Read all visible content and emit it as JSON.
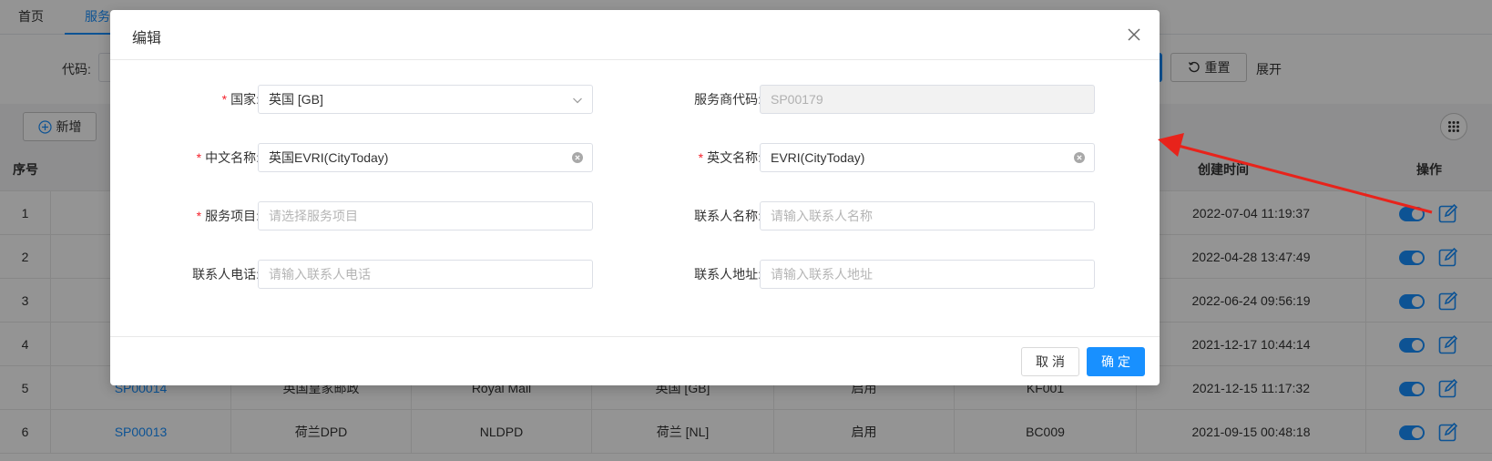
{
  "tabs": [
    "首页",
    "服务"
  ],
  "search": {
    "code_label": "代码:",
    "reset_label": "重置",
    "expand_label": "展开"
  },
  "toolbar": {
    "add_label": "新增"
  },
  "table": {
    "headers": {
      "index": "序号",
      "created": "创建时间",
      "actions": "操作"
    },
    "rows": [
      {
        "index": "1",
        "code": "",
        "cn": "",
        "en": "",
        "country": "",
        "status": "",
        "ext": "",
        "created": "2022-07-04 11:19:37"
      },
      {
        "index": "2",
        "code": "",
        "cn": "",
        "en": "",
        "country": "",
        "status": "",
        "ext": "",
        "created": "2022-04-28 13:47:49"
      },
      {
        "index": "3",
        "code": "",
        "cn": "",
        "en": "",
        "country": "",
        "status": "",
        "ext": "",
        "created": "2022-06-24 09:56:19"
      },
      {
        "index": "4",
        "code": "",
        "cn": "",
        "en": "",
        "country": "",
        "status": "",
        "ext": "",
        "created": "2021-12-17 10:44:14"
      },
      {
        "index": "5",
        "code": "SP00014",
        "cn": "英国皇家邮政",
        "en": "Royal Mail",
        "country": "英国 [GB]",
        "status": "启用",
        "ext": "KF001",
        "created": "2021-12-15 11:17:32"
      },
      {
        "index": "6",
        "code": "SP00013",
        "cn": "荷兰DPD",
        "en": "NLDPD",
        "country": "荷兰 [NL]",
        "status": "启用",
        "ext": "BC009",
        "created": "2021-09-15 00:48:18"
      }
    ]
  },
  "modal": {
    "title": "编辑",
    "fields": {
      "country": {
        "label": "国家:",
        "value": "英国 [GB]"
      },
      "provider_code": {
        "label": "服务商代码:",
        "value": "SP00179"
      },
      "cn_name": {
        "label": "中文名称:",
        "value": "英国EVRI(CityToday)"
      },
      "en_name": {
        "label": "英文名称:",
        "value": "EVRI(CityToday)"
      },
      "service_item": {
        "label": "服务项目:",
        "placeholder": "请选择服务项目"
      },
      "contact_name": {
        "label": "联系人名称:",
        "placeholder": "请输入联系人名称"
      },
      "contact_phone": {
        "label": "联系人电话:",
        "placeholder": "请输入联系人电话"
      },
      "contact_address": {
        "label": "联系人地址:",
        "placeholder": "请输入联系人地址"
      }
    },
    "required_mark": "*",
    "cancel_label": "取消",
    "confirm_label": "确定"
  },
  "colors": {
    "primary": "#1890ff",
    "required": "#f5222d",
    "annotation": "#e8231b"
  }
}
